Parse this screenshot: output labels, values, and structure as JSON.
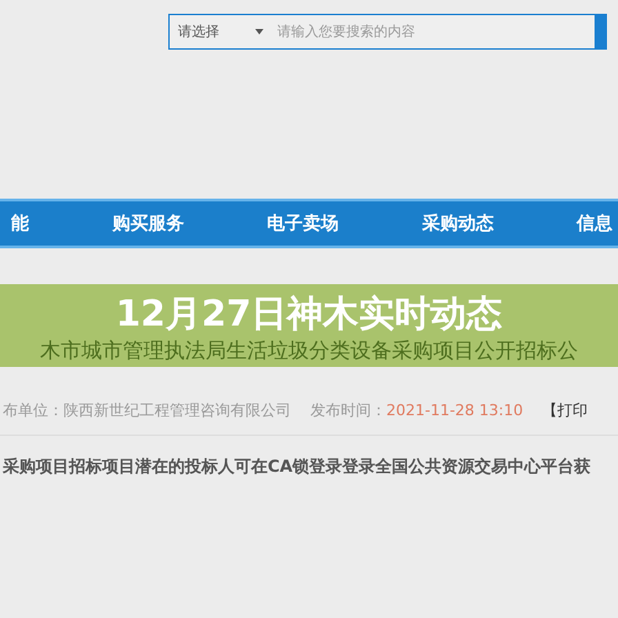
{
  "search": {
    "select": "请选择",
    "placeholder": "请输入您要搜索的内容"
  },
  "nav": [
    {
      "label": "能"
    },
    {
      "label": "购买服务"
    },
    {
      "label": "电子卖场"
    },
    {
      "label": "采购动态"
    },
    {
      "label": "信息"
    }
  ],
  "banner": {
    "title": "12月27日神木实时动态",
    "subtitle": "木市城市管理执法局生活垃圾分类设备采购项目公开招标公"
  },
  "info": {
    "publisher": "布单位：陕西新世纪工程管理咨询有限公司",
    "time_label": "发布时间：",
    "time": "2021-11-28 13:10",
    "print": "【打印"
  },
  "paragraph": "采购项目招标项目潜在的投标人可在CA锁登录登录全国公共资源交易中心平台获"
}
